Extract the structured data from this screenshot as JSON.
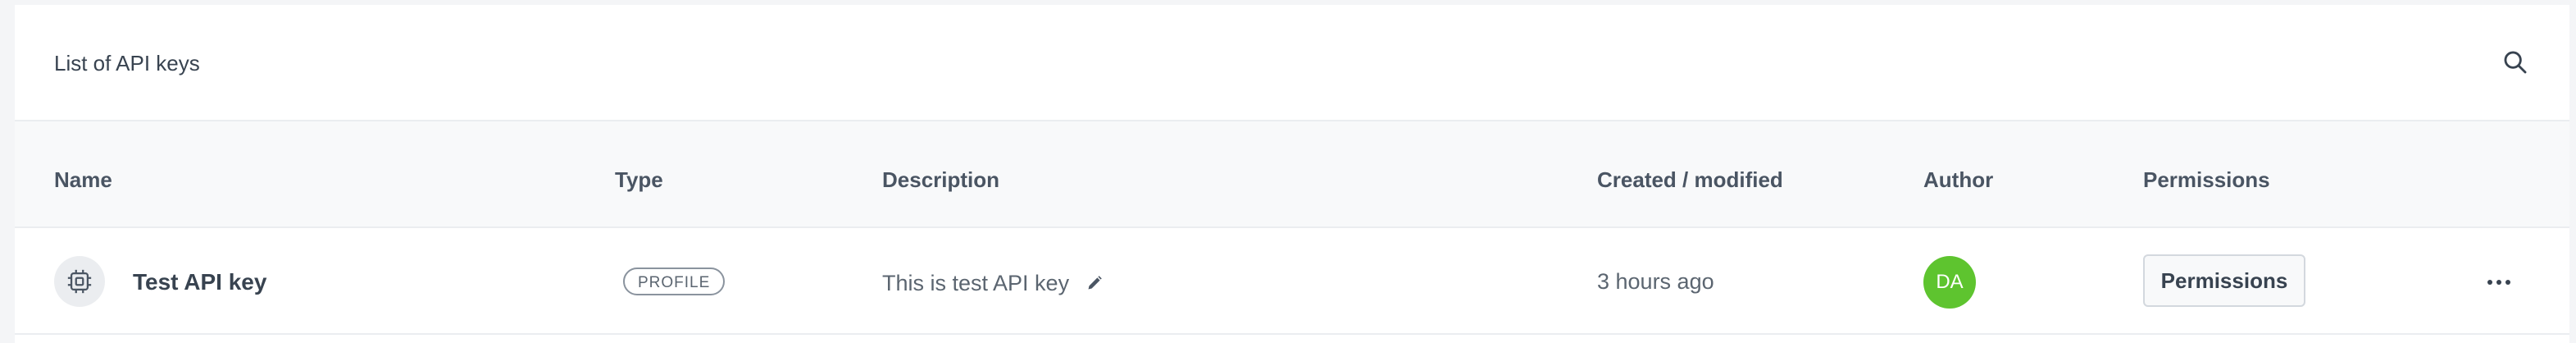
{
  "card": {
    "title": "List of API keys",
    "search_icon": "search-icon"
  },
  "table": {
    "columns": [
      "Name",
      "Type",
      "Description",
      "Created / modified",
      "Author",
      "Permissions"
    ],
    "rows": [
      {
        "icon": "chip-icon",
        "name": "Test API key",
        "type": "PROFILE",
        "description": "This is test API key",
        "edit_icon": "pencil-icon",
        "created": "3 hours ago",
        "author_initials": "DA",
        "permissions_label": "Permissions",
        "more_icon": "more-horizontal-icon"
      }
    ]
  },
  "colors": {
    "avatar": "#5ec42f",
    "header_bg": "#f8f9fa",
    "text": "#384350"
  }
}
